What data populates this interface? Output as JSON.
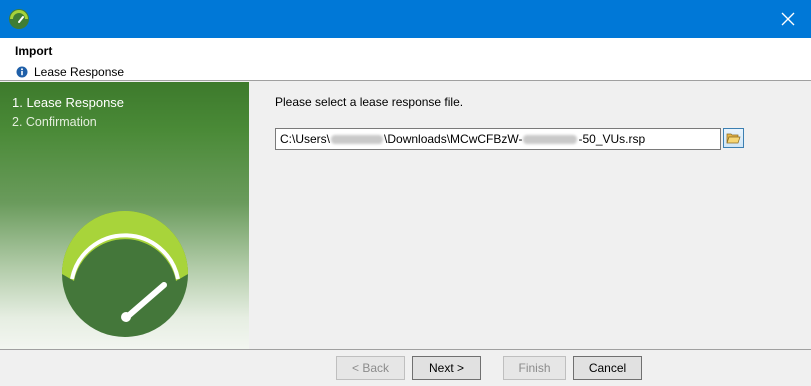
{
  "titlebar": {
    "app_icon": "app-logo-icon",
    "close_icon": "close-icon",
    "accent": "#0078d7"
  },
  "header": {
    "title": "Import",
    "subtitle": "Lease Response",
    "subtitle_icon": "info-icon"
  },
  "steps": [
    {
      "label": "1. Lease Response",
      "active": true
    },
    {
      "label": "2. Confirmation",
      "active": false
    }
  ],
  "main": {
    "prompt": "Please select a lease response file.",
    "path_parts": {
      "p1": "C:\\Users\\",
      "p2": "\\Downloads\\MCwCFBzW-",
      "p3": "-50_VUs.rsp"
    },
    "browse_icon": "folder-open-icon"
  },
  "buttons": {
    "back": "< Back",
    "next": "Next >",
    "finish": "Finish",
    "cancel": "Cancel"
  },
  "colors": {
    "brand_green": "#4a7c3a",
    "brand_lime": "#8cc63f"
  }
}
